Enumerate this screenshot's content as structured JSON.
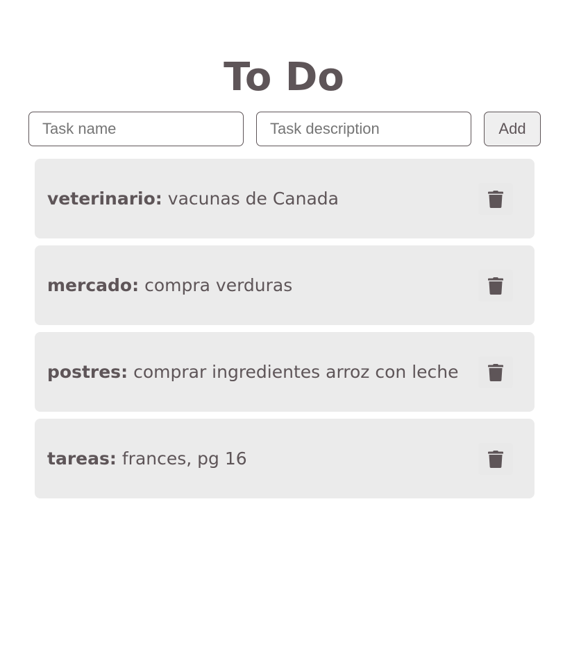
{
  "header": {
    "title": "To Do"
  },
  "form": {
    "name_placeholder": "Task name",
    "name_value": "",
    "description_placeholder": "Task description",
    "description_value": "",
    "add_label": "Add"
  },
  "tasks": [
    {
      "name": "veterinario:",
      "description": "vacunas de Canada"
    },
    {
      "name": "mercado:",
      "description": "compra verduras"
    },
    {
      "name": "postres:",
      "description": "comprar ingredientes arroz con leche"
    },
    {
      "name": "tareas:",
      "description": "frances, pg 16"
    }
  ],
  "icons": {
    "delete": "trash-icon"
  },
  "colors": {
    "text": "#5e5558",
    "card_background": "#ebebeb",
    "button_background": "#efefef"
  }
}
